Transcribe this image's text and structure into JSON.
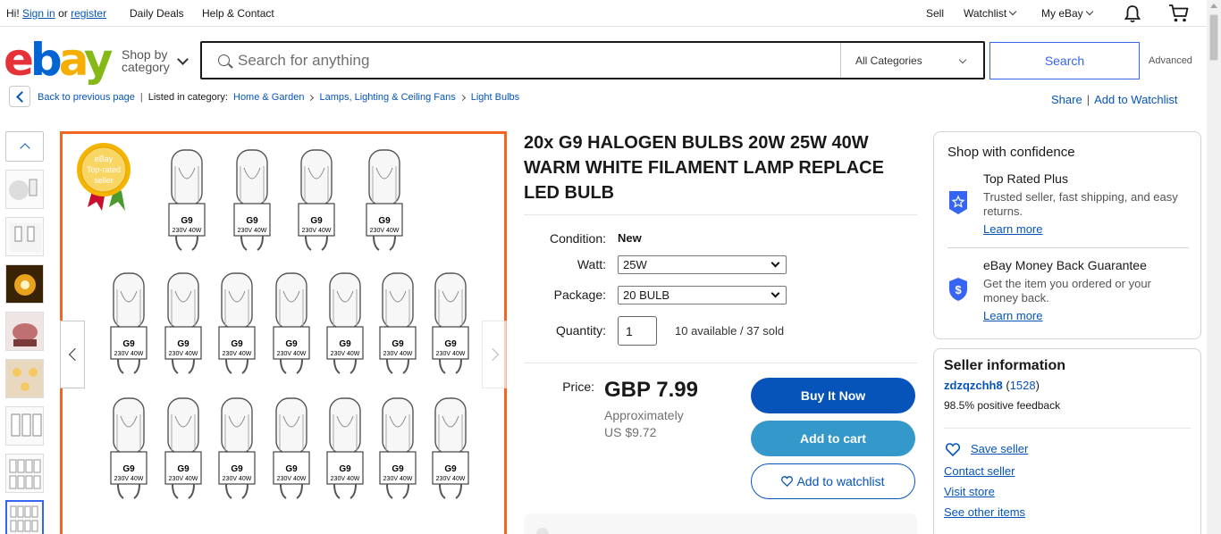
{
  "topbar": {
    "greeting": "Hi!",
    "sign_in": "Sign in",
    "or": "or",
    "register": "register",
    "daily_deals": "Daily Deals",
    "help": "Help & Contact",
    "sell": "Sell",
    "watchlist": "Watchlist",
    "my_ebay": "My eBay"
  },
  "header": {
    "logo": {
      "e": "e",
      "b": "b",
      "a": "a",
      "y": "y"
    },
    "shop_by_line1": "Shop by",
    "shop_by_line2": "category",
    "search_placeholder": "Search for anything",
    "category": "All Categories",
    "search_button": "Search",
    "advanced": "Advanced"
  },
  "breadcrumb": {
    "back": "Back to previous page",
    "listed_in": "Listed in category:",
    "items": [
      "Home & Garden",
      "Lamps, Lighting & Ceiling Fans",
      "Light Bulbs"
    ],
    "share": "Share",
    "add_watchlist": "Add to Watchlist"
  },
  "product": {
    "title": "20x G9 HALOGEN BULBS 20W 25W 40W WARM WHITE FILAMENT LAMP REPLACE LED BULB",
    "badge_line1": "eBay",
    "badge_line2": "Top-rated",
    "badge_line3": "seller",
    "bulb_label1": "G9",
    "bulb_label2": "230V 40W",
    "bulb_label3": "CE",
    "condition_label": "Condition:",
    "condition_value": "New",
    "watt_label": "Watt:",
    "watt_value": "25W",
    "package_label": "Package:",
    "package_value": "20 BULB",
    "quantity_label": "Quantity:",
    "quantity_value": "1",
    "availability": "10 available / 37 sold",
    "price_label": "Price:",
    "price": "GBP 7.99",
    "approx_label": "Approximately",
    "approx_value": "US $9.72",
    "buy_now": "Buy It Now",
    "add_to_cart": "Add to cart",
    "add_to_watchlist": "Add to watchlist"
  },
  "confidence": {
    "title": "Shop with confidence",
    "items": [
      {
        "title": "Top Rated Plus",
        "desc": "Trusted seller, fast shipping, and easy returns.",
        "link": "Learn more"
      },
      {
        "title": "eBay Money Back Guarantee",
        "desc": "Get the item you ordered or your money back.",
        "link": "Learn more"
      }
    ]
  },
  "seller": {
    "title": "Seller information",
    "name": "zdzqzchh8",
    "feedback_count": "1528",
    "positive": "98.5% positive feedback",
    "save": "Save seller",
    "contact": "Contact seller",
    "visit": "Visit store",
    "other": "See other items"
  },
  "colors": {
    "accent_blue": "#3665f3",
    "link_blue": "#0654ba",
    "buy_button": "#0654ba",
    "cart_button": "#3498ca",
    "image_border": "#f26522"
  },
  "icons": [
    "search-icon",
    "bell-icon",
    "cart-icon",
    "chevron-down-icon",
    "chevron-left-icon",
    "chevron-up-icon",
    "star-shield-icon",
    "dollar-shield-icon",
    "heart-icon"
  ]
}
